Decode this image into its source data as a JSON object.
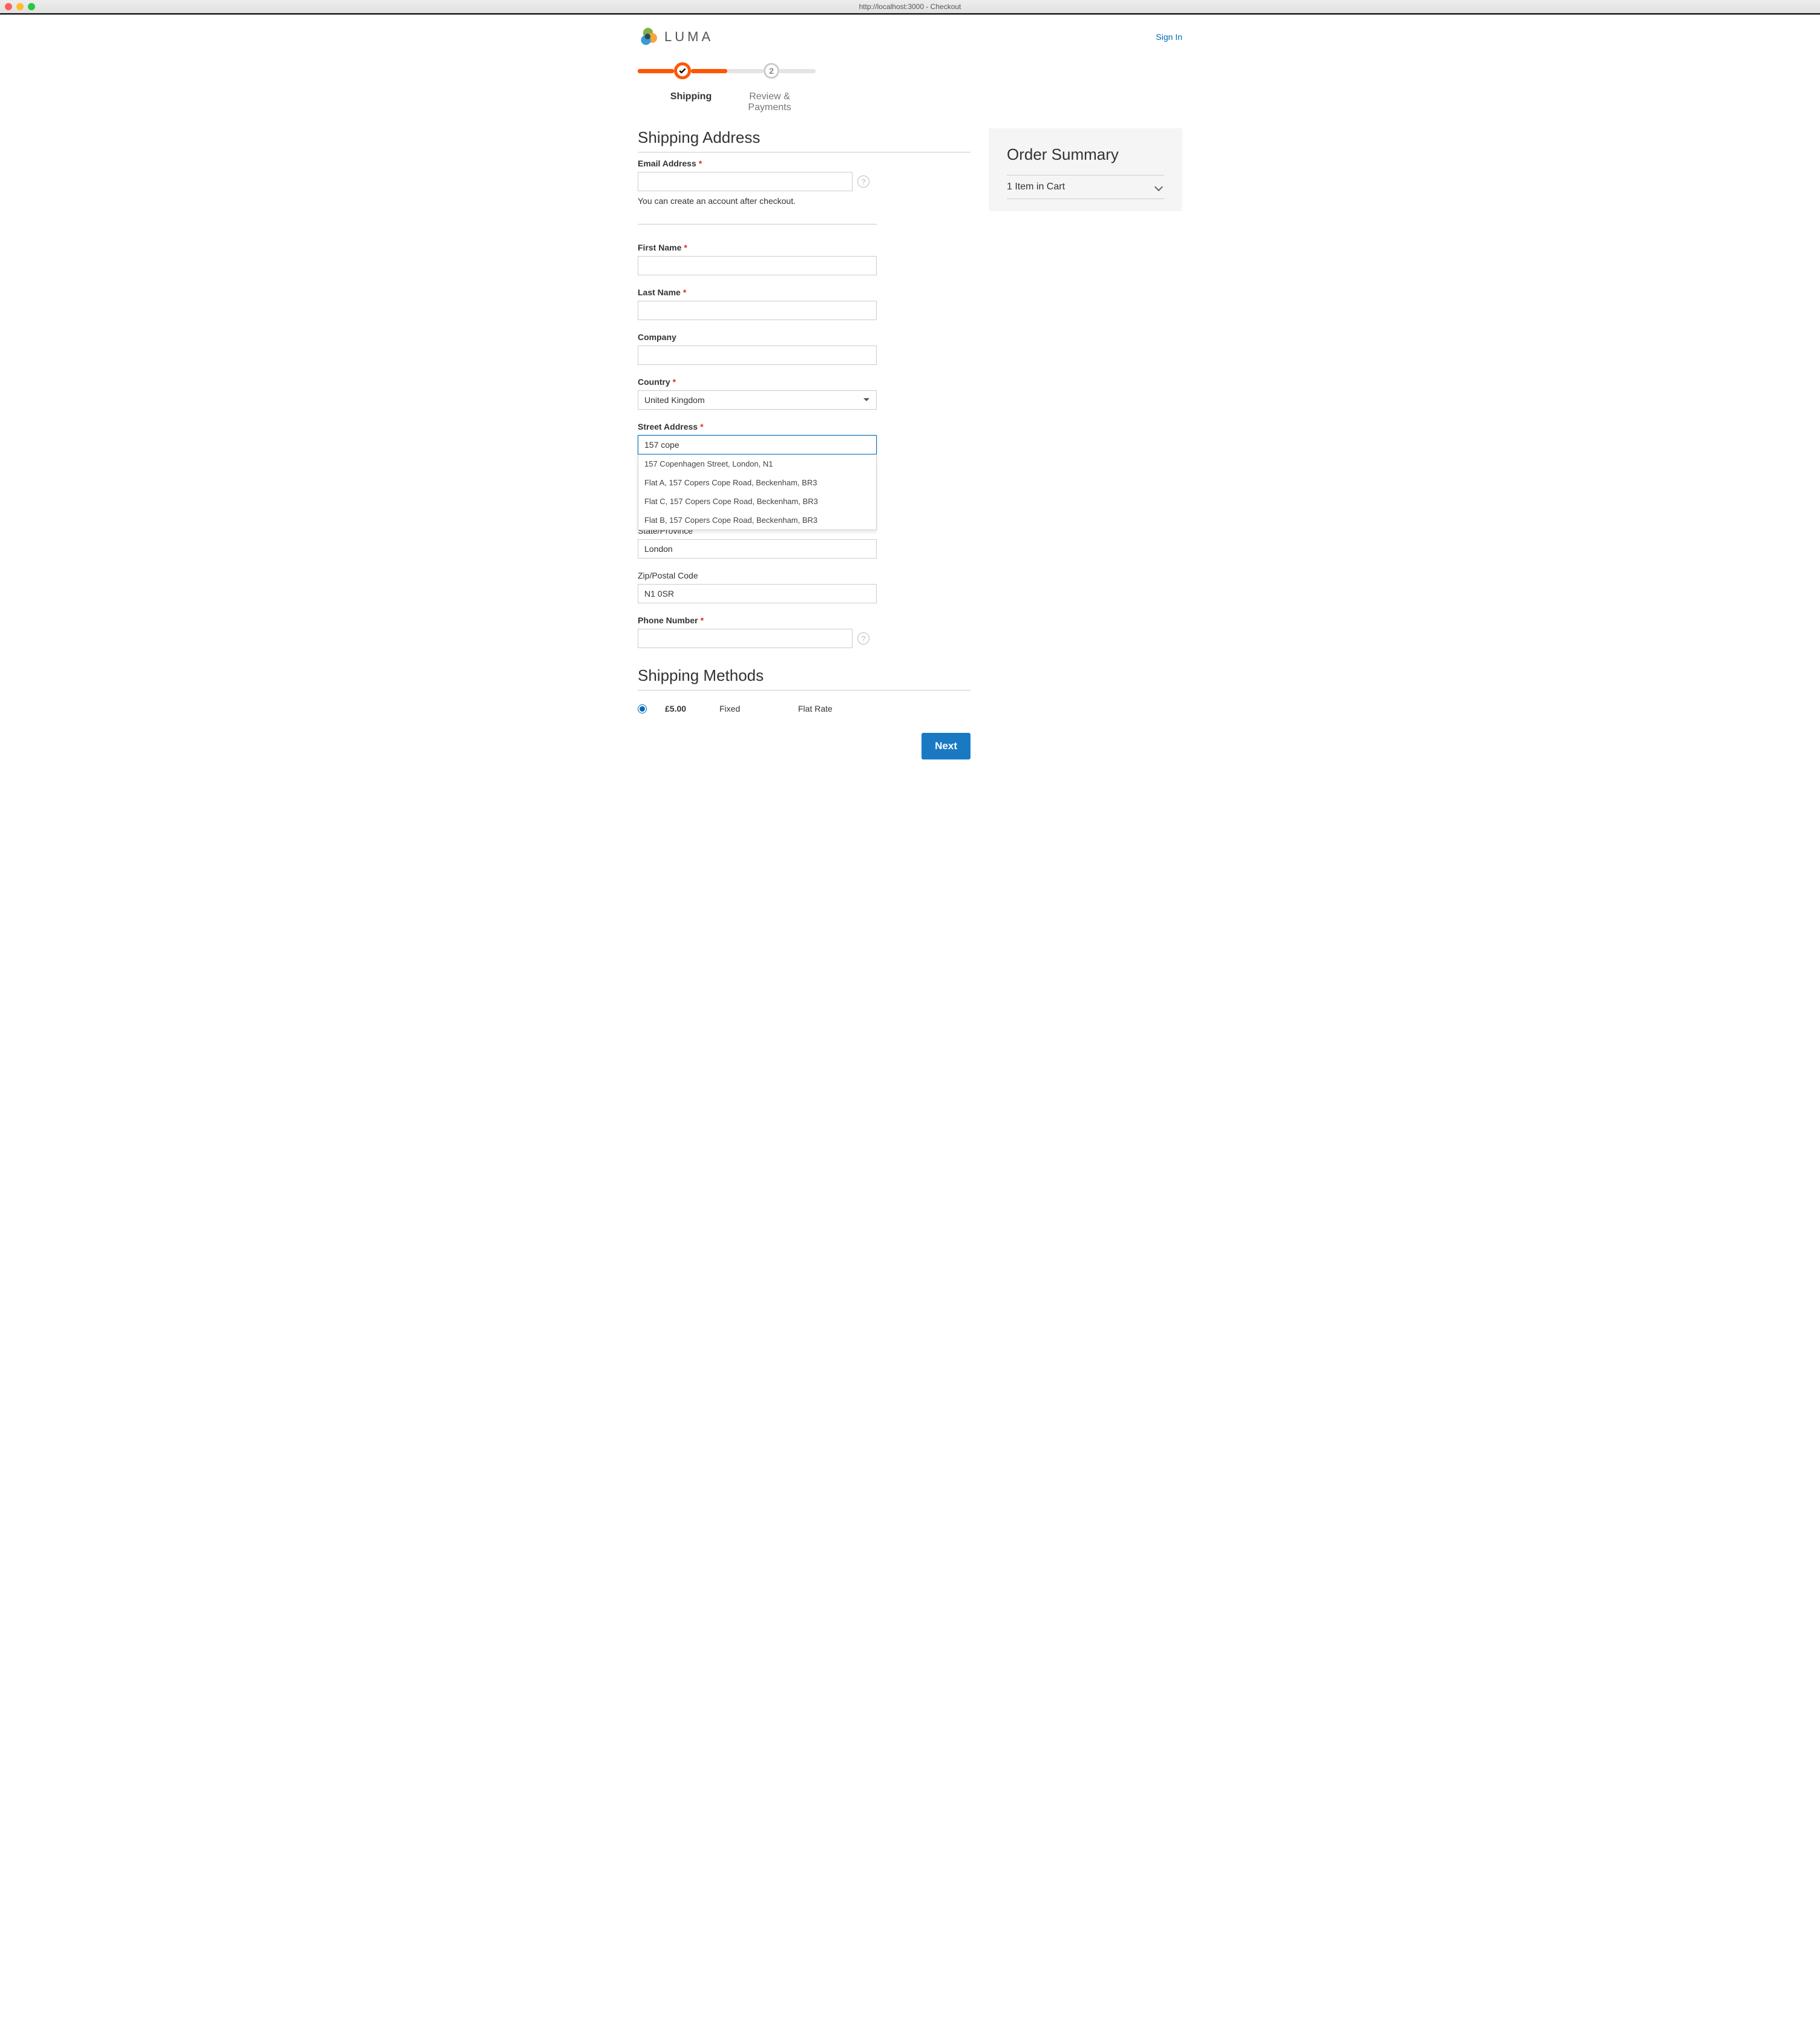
{
  "window": {
    "title": "http://localhost:3000 - Checkout"
  },
  "brand": {
    "name": "LUMA"
  },
  "header": {
    "signin": "Sign In"
  },
  "progress": {
    "step1_label": "Shipping",
    "step2_number": "2",
    "step2_label": "Review & Payments"
  },
  "shipping_address": {
    "title": "Shipping Address",
    "email_label": "Email Address",
    "email_value": "",
    "email_hint": "You can create an account after checkout.",
    "firstname_label": "First Name",
    "firstname_value": "",
    "lastname_label": "Last Name",
    "lastname_value": "",
    "company_label": "Company",
    "company_value": "",
    "country_label": "Country",
    "country_value": "United Kingdom",
    "street_label": "Street Address",
    "street_value": "157 cope",
    "autocomplete": [
      "157 Copenhagen Street, London, N1",
      "Flat A, 157 Copers Cope Road, Beckenham, BR3",
      "Flat C, 157 Copers Cope Road, Beckenham, BR3",
      "Flat B, 157 Copers Cope Road, Beckenham, BR3"
    ],
    "state_label": "State/Province",
    "state_value": "London",
    "zip_label": "Zip/Postal Code",
    "zip_value": "N1 0SR",
    "phone_label": "Phone Number",
    "phone_value": ""
  },
  "shipping_methods": {
    "title": "Shipping Methods",
    "price": "£5.00",
    "name": "Fixed",
    "carrier": "Flat Rate"
  },
  "order_summary": {
    "title": "Order Summary",
    "items_label": "1 Item in Cart"
  },
  "buttons": {
    "next": "Next"
  }
}
